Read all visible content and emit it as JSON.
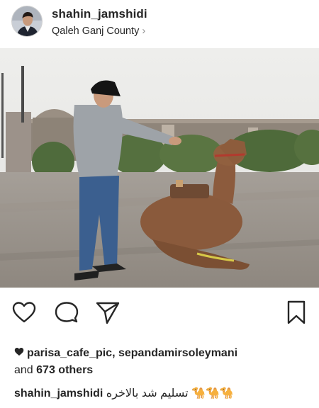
{
  "post": {
    "username": "shahin_jamshidi",
    "location": "Qaleh Ganj County",
    "location_chevron": "›"
  },
  "actions": {
    "icons": [
      "heart-outline-icon",
      "comment-icon",
      "share-send-icon",
      "bookmark-icon"
    ]
  },
  "likes": {
    "names": "parisa_cafe_pic, sepandamirsoleymani",
    "and_label": "and",
    "others": "673 others"
  },
  "caption": {
    "username": "shahin_jamshidi",
    "text": "تسلیم شد بالاخره 🐪🐪🐪"
  },
  "colors": {
    "text": "#262626",
    "secondary": "#8e8e8e",
    "sky": "#e8e8e6"
  }
}
